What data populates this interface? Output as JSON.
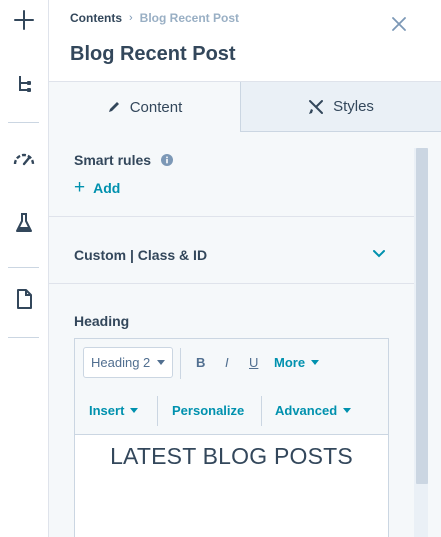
{
  "rail": {
    "items": [
      {
        "icon": "plus-icon"
      },
      {
        "icon": "tree-structure-icon"
      },
      {
        "icon": "speedometer-icon"
      },
      {
        "icon": "flask-icon"
      },
      {
        "icon": "document-icon"
      }
    ]
  },
  "header": {
    "breadcrumb": {
      "parent": "Contents",
      "separator": "›",
      "current": "Blog Recent Post"
    },
    "title": "Blog Recent Post",
    "close_icon": "close-icon"
  },
  "tabs": [
    {
      "label": "Content",
      "icon": "pencil-icon",
      "active": true
    },
    {
      "label": "Styles",
      "icon": "brush-icon",
      "active": false
    }
  ],
  "smart_rules": {
    "label": "Smart rules",
    "add_label": "Add"
  },
  "custom_class": {
    "label": "Custom | Class & ID"
  },
  "heading": {
    "label": "Heading",
    "toolbar": {
      "format_select": "Heading 2",
      "bold": "B",
      "italic": "I",
      "underline": "U",
      "more": "More",
      "insert": "Insert",
      "personalize": "Personalize",
      "advanced": "Advanced"
    },
    "content": "LATEST BLOG POSTS"
  },
  "colors": {
    "accent": "#0091ae",
    "text": "#33475b",
    "panel_bg": "#f5f8fa",
    "border": "#cbd6e2"
  }
}
